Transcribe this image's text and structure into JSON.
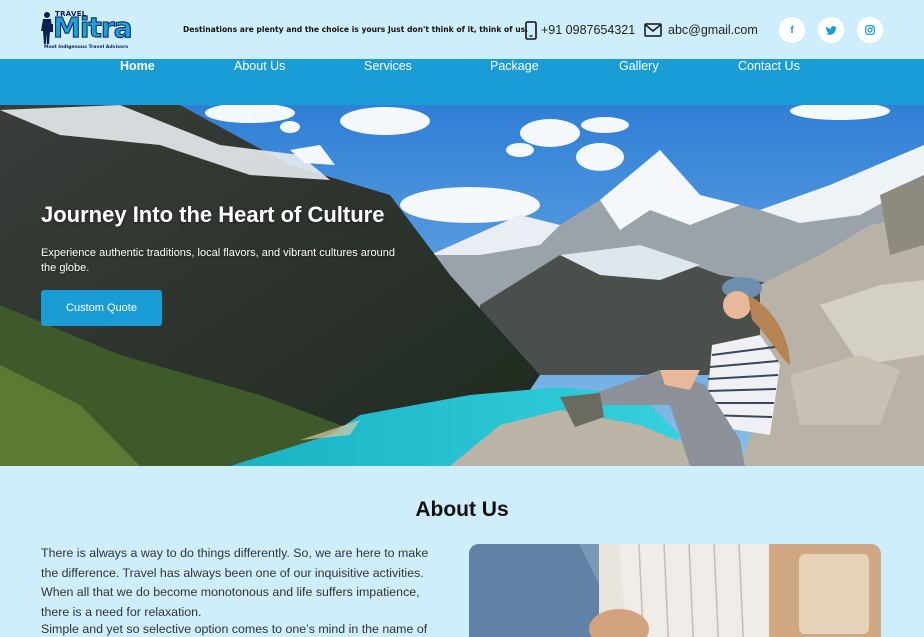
{
  "brand": {
    "top_word": "TRAVEL",
    "name": "Mitra",
    "tagline": "Most Indigenous Travel Advisors"
  },
  "header": {
    "slogan": "Destinations are plenty and the choice is yours Just don't think of it, think of us.",
    "phone": "+91 0987654321",
    "email": "abc@gmail.com",
    "social": [
      {
        "icon": "facebook-icon",
        "glyph": "f"
      },
      {
        "icon": "twitter-icon",
        "glyph": ""
      },
      {
        "icon": "instagram-icon",
        "glyph": ""
      }
    ]
  },
  "nav": {
    "items": [
      {
        "label": "Home",
        "active": true
      },
      {
        "label": "About Us"
      },
      {
        "label": "Services"
      },
      {
        "label": "Package"
      },
      {
        "label": "Gallery"
      },
      {
        "label": "Contact Us"
      }
    ]
  },
  "hero": {
    "title": "Journey Into the Heart of Culture",
    "subtitle": "Experience authentic traditions, local flavors, and vibrant cultures around the globe.",
    "cta_label": "Custom Quote"
  },
  "about": {
    "heading": "About Us",
    "lines": [
      "There is always a way to do things differently. So, we are here to make",
      "the difference. Travel has always been one of our inquisitive activities.",
      "When all that we do become monotonous and life suffers impatience,",
      "there is a need for relaxation.",
      "Simple and yet so selective option comes to one’s mind in the name of"
    ]
  },
  "colors": {
    "page_bg": "#cfeefc",
    "primary": "#1a9cd6",
    "navy": "#0b1f4d"
  }
}
